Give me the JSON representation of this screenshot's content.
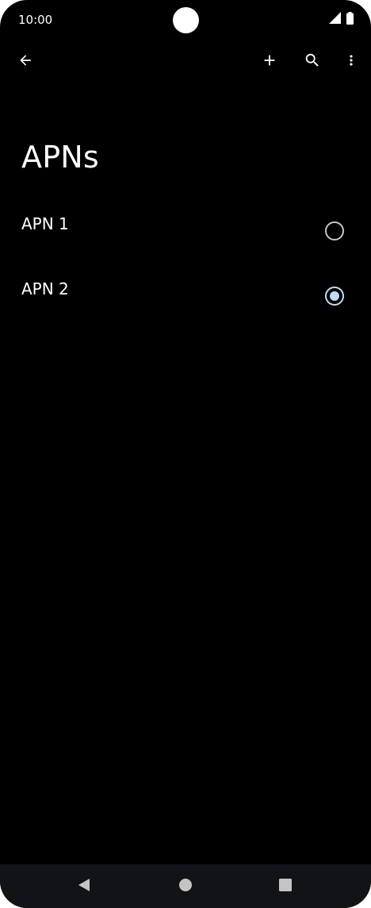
{
  "status_bar": {
    "time": "10:00",
    "icons": [
      "signal-icon",
      "battery-icon"
    ]
  },
  "app_bar": {
    "actions": [
      "back-arrow-icon",
      "add-icon",
      "search-icon",
      "more-vert-icon"
    ]
  },
  "page": {
    "title": "APNs"
  },
  "apns": [
    {
      "label": "APN 1",
      "selected": false
    },
    {
      "label": "APN 2",
      "selected": true
    }
  ],
  "nav_bar": {
    "buttons": [
      "nav-back-icon",
      "nav-home-icon",
      "nav-recents-icon"
    ]
  },
  "colors": {
    "background": "#000000",
    "text": "#ffffff",
    "radio_unselected": "#c6c6c6",
    "radio_selected": "#c3dcf5",
    "nav_bar": "#111316"
  }
}
